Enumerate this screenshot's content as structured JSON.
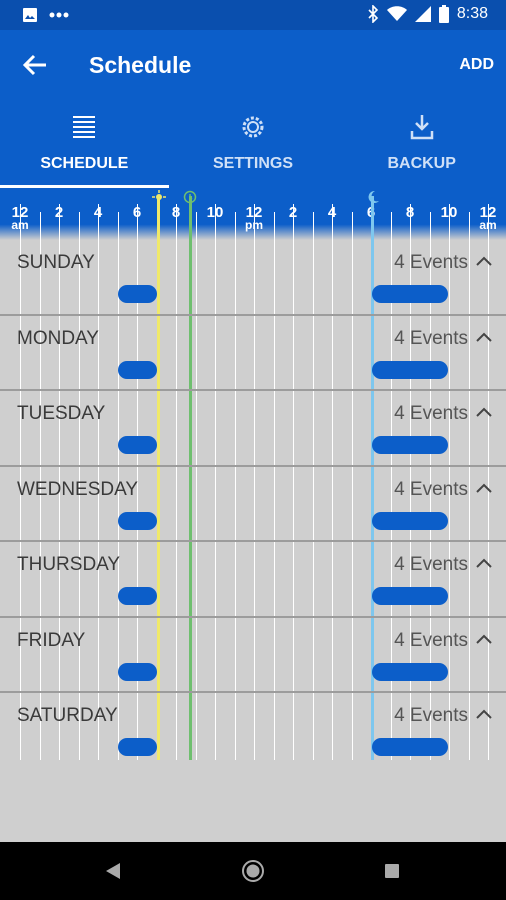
{
  "status": {
    "time": "8:38"
  },
  "appbar": {
    "title": "Schedule",
    "add_label": "ADD"
  },
  "tabs": [
    {
      "label": "SCHEDULE",
      "icon": "list-icon"
    },
    {
      "label": "SETTINGS",
      "icon": "gear-icon"
    },
    {
      "label": "BACKUP",
      "icon": "download-icon"
    }
  ],
  "ruler": {
    "ticks": [
      "12",
      "2",
      "4",
      "6",
      "8",
      "10",
      "12",
      "2",
      "4",
      "6",
      "8",
      "10",
      "12"
    ],
    "subs": {
      "first": "am",
      "middle": "pm",
      "last": "am"
    }
  },
  "markers": {
    "sunrise_color": "#f0e96a",
    "now_color": "#6fbf6f",
    "sunset_color": "#7ec7ee"
  },
  "days": [
    {
      "name": "SUNDAY",
      "events": "4 Events"
    },
    {
      "name": "MONDAY",
      "events": "4 Events"
    },
    {
      "name": "TUESDAY",
      "events": "4 Events"
    },
    {
      "name": "WEDNESDAY",
      "events": "4 Events"
    },
    {
      "name": "THURSDAY",
      "events": "4 Events"
    },
    {
      "name": "FRIDAY",
      "events": "4 Events"
    },
    {
      "name": "SATURDAY",
      "events": "4 Events"
    }
  ]
}
